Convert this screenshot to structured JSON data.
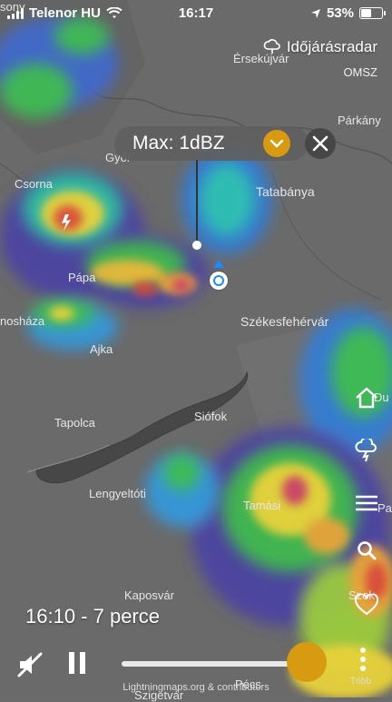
{
  "status_bar": {
    "carrier": "Telenor HU",
    "time": "16:17",
    "battery": "53%",
    "battery_level": 0.53
  },
  "radar": {
    "title": "Időjárásradar",
    "source": "OMSZ",
    "max_label": "Max: 1dBZ"
  },
  "map_labels": [
    {
      "text": "Érsekújvár"
    },
    {
      "text": "Párkány"
    },
    {
      "text": "Győr"
    },
    {
      "text": "Csorna"
    },
    {
      "text": "Tatabánya"
    },
    {
      "text": "Pápa"
    },
    {
      "text": "Székesfehérvár"
    },
    {
      "text": "nosháza"
    },
    {
      "text": "Ajka"
    },
    {
      "text": "Tapolca"
    },
    {
      "text": "Siófok"
    },
    {
      "text": "Lengyeltóti"
    },
    {
      "text": "Tamási"
    },
    {
      "text": "Kaposvár"
    },
    {
      "text": "Szek"
    },
    {
      "text": "Du"
    },
    {
      "text": "Pa"
    },
    {
      "text": "sony"
    },
    {
      "text": "Pécs"
    },
    {
      "text": "Szigetvár"
    }
  ],
  "playback": {
    "timestamp": "16:10 - 7 perce",
    "progress": 0.92,
    "more_label": "Több",
    "credit": "Lightningmaps.org & contributors"
  },
  "colors": {
    "accent": "#d89a10",
    "location_blue": "#1a8cff"
  }
}
